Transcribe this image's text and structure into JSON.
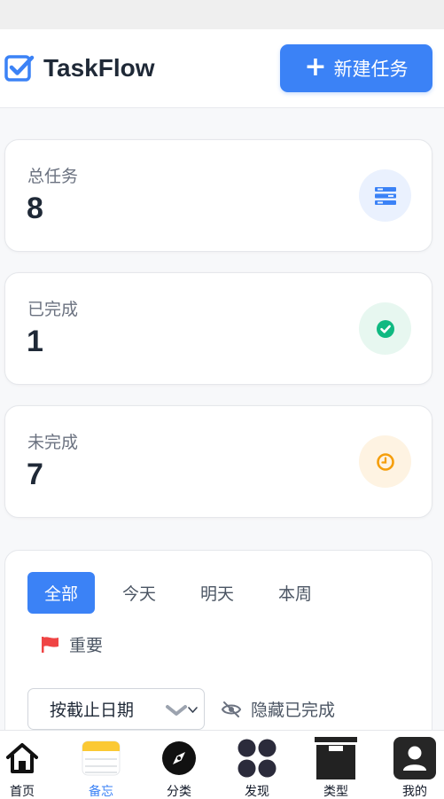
{
  "app": {
    "title": "TaskFlow",
    "new_task_label": "新建任务"
  },
  "stats": [
    {
      "label": "总任务",
      "value": "8",
      "icon": "list-icon",
      "color": "#3b82f6"
    },
    {
      "label": "已完成",
      "value": "1",
      "icon": "check-circle-icon",
      "color": "#10b981"
    },
    {
      "label": "未完成",
      "value": "7",
      "icon": "clock-icon",
      "color": "#f59e0b"
    }
  ],
  "filters": {
    "tabs": [
      "全部",
      "今天",
      "明天",
      "本周"
    ],
    "active_tab": "全部",
    "important_label": "重要",
    "sort_value": "按截止日期",
    "hide_completed_label": "隐藏已完成"
  },
  "tabbar": {
    "items": [
      {
        "label": "首页",
        "icon": "home-icon"
      },
      {
        "label": "备忘",
        "icon": "notes-icon"
      },
      {
        "label": "分类",
        "icon": "compass-icon"
      },
      {
        "label": "发现",
        "icon": "grid-icon"
      },
      {
        "label": "类型",
        "icon": "archive-icon"
      },
      {
        "label": "我的",
        "icon": "user-icon"
      }
    ],
    "active": "备忘"
  },
  "colors": {
    "accent": "#3b82f6",
    "success": "#10b981",
    "warning": "#f59e0b",
    "flag": "#ef4444"
  }
}
